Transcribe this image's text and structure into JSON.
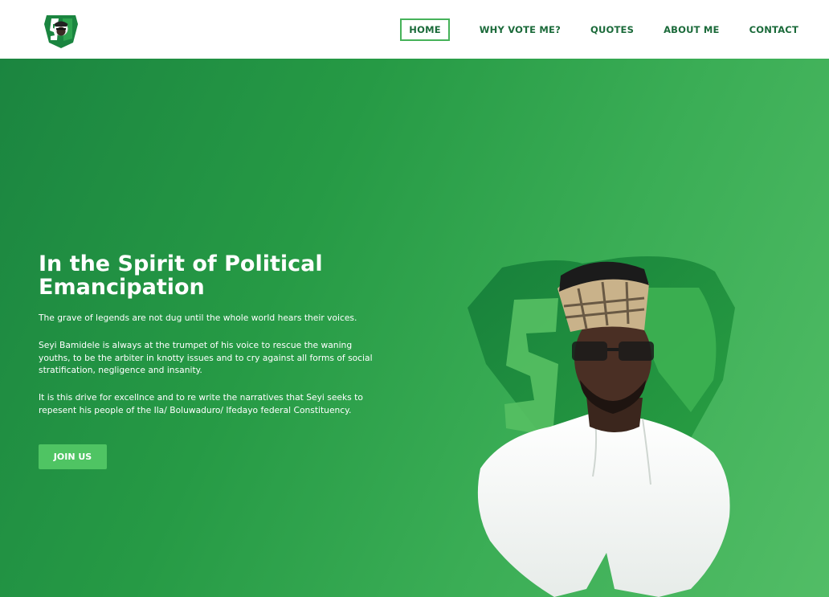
{
  "brand": {
    "logo_icon": "sb-monogram-logo-icon",
    "colors": {
      "primary": "#1b8540",
      "accent": "#4fc463",
      "nav_text": "#1b6a3a"
    }
  },
  "nav": {
    "items": [
      {
        "label": "HOME",
        "active": true
      },
      {
        "label": "WHY VOTE ME?"
      },
      {
        "label": "QUOTES"
      },
      {
        "label": "ABOUT ME"
      },
      {
        "label": "CONTACT"
      }
    ]
  },
  "hero": {
    "title_line1": "In the Spirit of Political",
    "title_line2": "Emancipation",
    "paragraphs": [
      "The grave of legends are not dug until the whole world hears their voices.",
      "Seyi Bamidele is always at the trumpet of his voice to rescue the waning youths, to be the arbiter in knotty issues and to cry against all forms of social stratification, negligence and insanity.",
      "It is this drive for excellnce and to re write the narratives that Seyi seeks to repesent his people of the Ila/ Boluwaduro/ Ifedayo federal Constituency."
    ],
    "cta_label": "JOIN US",
    "image_icon": "candidate-portrait-with-shield-logo"
  }
}
